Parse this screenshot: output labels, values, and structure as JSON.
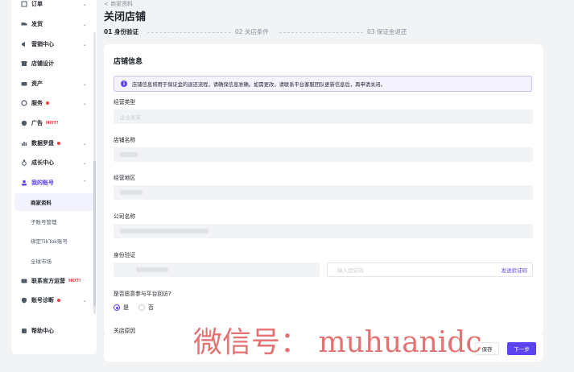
{
  "sidebar": {
    "items": [
      {
        "label": "订单",
        "icon": "order-icon",
        "chevron": "⌄"
      },
      {
        "label": "发货",
        "icon": "truck-icon",
        "chevron": "⌄"
      },
      {
        "label": "营销中心",
        "icon": "megaphone-icon",
        "chevron": "⌄"
      },
      {
        "label": "店铺设计",
        "icon": "store-icon",
        "chevron": ""
      },
      {
        "label": "资产",
        "icon": "wallet-icon",
        "chevron": "⌄"
      },
      {
        "label": "服务",
        "icon": "service-icon",
        "chevron": "⌄",
        "dot": true
      },
      {
        "label": "广告",
        "icon": "ad-icon",
        "chevron": "",
        "badge": "HOT!"
      },
      {
        "label": "数据罗盘",
        "icon": "chart-icon",
        "chevron": "⌄",
        "dot": true
      },
      {
        "label": "成长中心",
        "icon": "medal-icon",
        "chevron": "⌄"
      },
      {
        "label": "我的账号",
        "icon": "user-icon",
        "chevron": "⌃"
      }
    ],
    "sub_items": [
      "商家资料",
      "子账号管理",
      "绑定TikTok账号",
      "全球市场"
    ],
    "lower_items": [
      {
        "label": "联系官方运营",
        "icon": "contact-icon",
        "badge": "HOT!"
      },
      {
        "label": "账号诊断",
        "icon": "shield-icon",
        "chevron": "⌄",
        "dot": true
      },
      {
        "label": "帮助中心",
        "icon": "help-icon"
      }
    ]
  },
  "header": {
    "breadcrumb": "< 商家资料",
    "title": "关闭店铺"
  },
  "steps": [
    "01 身份验证",
    "02 关店条件",
    "03 保证金退还"
  ],
  "card": {
    "title": "店铺信息",
    "notice": "店铺信息将用于保证金的退还流程，请确保信息准确。如需更改，请联系平台客服团队更新信息后，再申请关闭。",
    "fields": {
      "business_type_label": "经营类型",
      "business_type_value": "企业卖家",
      "store_name_label": "店铺名称",
      "region_label": "经营地区",
      "company_label": "公司名称",
      "verify_label": "身份验证",
      "code_placeholder": "输入验证码",
      "send_code": "发送验证码",
      "question_label": "是否愿意参与平台回访?",
      "yes": "是",
      "no": "否",
      "reason_label": "关店原因"
    }
  },
  "footer": {
    "secondary_label": "保存",
    "primary_label": "下一步"
  },
  "watermark": "微信号： muhuanidc"
}
